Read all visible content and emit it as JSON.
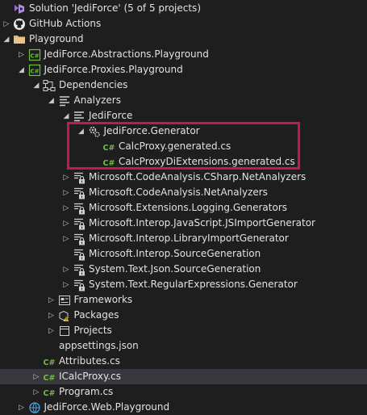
{
  "tree": {
    "rows": [
      {
        "label": "Solution 'JediForce' (5 of 5 projects)",
        "icon": "solution-icon",
        "state": "none",
        "depth": 0,
        "name": "tree-item-solution"
      },
      {
        "label": "GitHub Actions",
        "icon": "github-icon",
        "state": "collapsed",
        "depth": 0,
        "name": "tree-item-github-actions"
      },
      {
        "label": "Playground",
        "icon": "folder-icon",
        "state": "expanded",
        "depth": 0,
        "name": "tree-item-playground"
      },
      {
        "label": "JediForce.Abstractions.Playground",
        "icon": "csharp-project-icon",
        "state": "collapsed",
        "depth": 1,
        "name": "tree-item-abstractions-playground"
      },
      {
        "label": "JediForce.Proxies.Playground",
        "icon": "csharp-project-icon",
        "state": "expanded",
        "depth": 1,
        "name": "tree-item-proxies-playground"
      },
      {
        "label": "Dependencies",
        "icon": "dependencies-icon",
        "state": "expanded",
        "depth": 2,
        "name": "tree-item-dependencies"
      },
      {
        "label": "Analyzers",
        "icon": "analyzer-icon",
        "state": "expanded",
        "depth": 3,
        "name": "tree-item-analyzers"
      },
      {
        "label": "JediForce",
        "icon": "analyzer-icon",
        "state": "expanded",
        "depth": 4,
        "name": "tree-item-jediforce-analyzer"
      },
      {
        "label": "JediForce.Generator",
        "icon": "generator-icon",
        "state": "expanded",
        "depth": 5,
        "name": "tree-item-jediforce-generator"
      },
      {
        "label": "CalcProxy.generated.cs",
        "icon": "csharp-file-icon",
        "state": "none",
        "depth": 6,
        "name": "tree-item-calcproxy-generated"
      },
      {
        "label": "CalcProxyDiExtensions.generated.cs",
        "icon": "csharp-file-icon",
        "state": "none",
        "depth": 6,
        "name": "tree-item-calcproxydiextensions-generated"
      },
      {
        "label": "Microsoft.CodeAnalysis.CSharp.NetAnalyzers",
        "icon": "analyzer-locked-icon",
        "state": "collapsed",
        "depth": 4,
        "name": "tree-item-csharp-netanalyzers"
      },
      {
        "label": "Microsoft.CodeAnalysis.NetAnalyzers",
        "icon": "analyzer-locked-icon",
        "state": "collapsed",
        "depth": 4,
        "name": "tree-item-netanalyzers"
      },
      {
        "label": "Microsoft.Extensions.Logging.Generators",
        "icon": "analyzer-locked-icon",
        "state": "collapsed",
        "depth": 4,
        "name": "tree-item-logging-generators"
      },
      {
        "label": "Microsoft.Interop.JavaScript.JSImportGenerator",
        "icon": "analyzer-locked-icon",
        "state": "collapsed",
        "depth": 4,
        "name": "tree-item-jsimportgenerator"
      },
      {
        "label": "Microsoft.Interop.LibraryImportGenerator",
        "icon": "analyzer-locked-icon",
        "state": "collapsed",
        "depth": 4,
        "name": "tree-item-libraryimportgenerator"
      },
      {
        "label": "Microsoft.Interop.SourceGeneration",
        "icon": "analyzer-locked-icon",
        "state": "none",
        "depth": 4,
        "name": "tree-item-sourcegeneration"
      },
      {
        "label": "System.Text.Json.SourceGeneration",
        "icon": "analyzer-locked-icon",
        "state": "collapsed",
        "depth": 4,
        "name": "tree-item-json-sourcegeneration"
      },
      {
        "label": "System.Text.RegularExpressions.Generator",
        "icon": "analyzer-locked-icon",
        "state": "collapsed",
        "depth": 4,
        "name": "tree-item-regex-generator"
      },
      {
        "label": "Frameworks",
        "icon": "framework-icon",
        "state": "collapsed",
        "depth": 3,
        "name": "tree-item-frameworks"
      },
      {
        "label": "Packages",
        "icon": "package-warning-icon",
        "state": "collapsed",
        "depth": 3,
        "name": "tree-item-packages"
      },
      {
        "label": "Projects",
        "icon": "projects-icon",
        "state": "collapsed",
        "depth": 3,
        "name": "tree-item-projects"
      },
      {
        "label": "appsettings.json",
        "icon": "json-file-icon",
        "state": "none",
        "depth": 2,
        "name": "tree-item-appsettings"
      },
      {
        "label": "Attributes.cs",
        "icon": "csharp-file-icon",
        "state": "none",
        "depth": 2,
        "name": "tree-item-attributes"
      },
      {
        "label": "ICalcProxy.cs",
        "icon": "csharp-file-icon",
        "state": "collapsed",
        "depth": 2,
        "name": "tree-item-icalcproxy",
        "selected": true
      },
      {
        "label": "Program.cs",
        "icon": "csharp-file-icon",
        "state": "collapsed",
        "depth": 2,
        "name": "tree-item-program"
      },
      {
        "label": "JediForce.Web.Playground",
        "icon": "web-project-icon",
        "state": "collapsed",
        "depth": 1,
        "name": "tree-item-web-playground"
      }
    ]
  },
  "colors": {
    "background": "#1e1e1e",
    "selected_row": "#37373d",
    "highlight_box": "#c2185b",
    "csharp_green": "#6fbf40",
    "folder_tan": "#dcb67a"
  }
}
